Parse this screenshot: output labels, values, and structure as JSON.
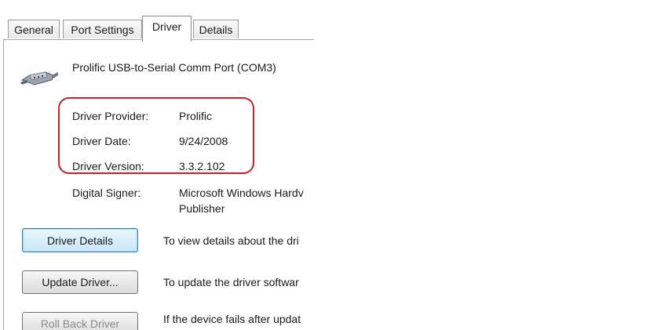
{
  "tabs": [
    {
      "label": "General"
    },
    {
      "label": "Port Settings"
    },
    {
      "label": "Driver"
    },
    {
      "label": "Details"
    }
  ],
  "device": {
    "name": "Prolific USB-to-Serial Comm Port (COM3)",
    "icon": "serial-port-icon"
  },
  "info": {
    "provider_label": "Driver Provider:",
    "provider_value": "Prolific",
    "date_label": "Driver Date:",
    "date_value": "9/24/2008",
    "version_label": "Driver Version:",
    "version_value": "3.3.2.102",
    "signer_label": "Digital Signer:",
    "signer_value_line1": "Microsoft Windows Hardv",
    "signer_value_line2": "Publisher"
  },
  "buttons": {
    "driver_details": "Driver Details",
    "driver_details_desc": "To view details about the dri",
    "update_driver": "Update Driver...",
    "update_driver_desc": "To update the driver softwar",
    "roll_back": "Roll Back Driver",
    "roll_back_desc": "If the device fails after updat"
  },
  "colors": {
    "highlight": "#c8202a",
    "focus": "#3c7fb1"
  }
}
